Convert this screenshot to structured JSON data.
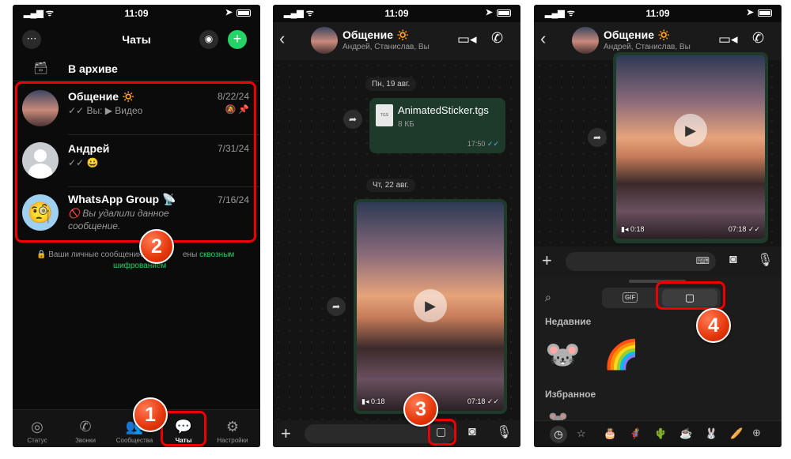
{
  "status": {
    "time": "11:09"
  },
  "screen1": {
    "title": "Чаты",
    "archive": "В архиве",
    "chats": [
      {
        "name": "Общение 🔅",
        "date": "8/22/24",
        "preview": "✓✓ Вы: ▶ Видео"
      },
      {
        "name": "Андрей",
        "date": "7/31/24",
        "preview": "✓✓ 😀"
      },
      {
        "name": "WhatsApp Group 📡",
        "date": "7/16/24",
        "preview": "🚫 Вы удалили данное сообщение."
      }
    ],
    "encryption_a": "Ваши личные сообщения",
    "encryption_b": "ены",
    "encryption_link1": "сквозным",
    "encryption_link2": "шифрованием",
    "tabs": [
      "Статус",
      "Звонки",
      "Сообщества",
      "Чаты",
      "Настройки"
    ]
  },
  "screen2": {
    "title": "Общение 🔅",
    "members": "Андрей, Станислав, Вы",
    "date1": "Пн, 19 авг.",
    "file_name": "AnimatedSticker.tgs",
    "file_ext": "TGS",
    "file_size": "8 КБ",
    "file_time": "17:50",
    "date2": "Чт, 22 авг.",
    "video_duration": "0:18",
    "video_time": "07:18"
  },
  "screen3": {
    "title": "Общение 🔅",
    "members": "Андрей, Станислав, Вы",
    "video_duration": "0:18",
    "video_time": "07:18",
    "gif_label": "GIF",
    "recent": "Недавние",
    "favorites": "Избранное"
  },
  "badges": [
    "1",
    "2",
    "3",
    "4"
  ],
  "colors": {
    "accent_green": "#25d366",
    "highlight_red": "#ee0000"
  }
}
